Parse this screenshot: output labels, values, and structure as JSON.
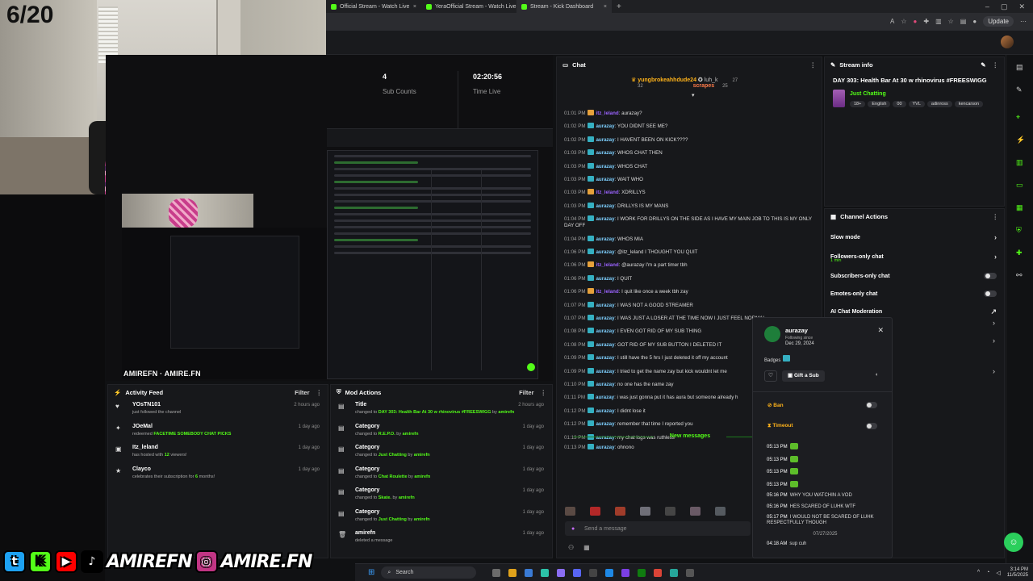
{
  "overlay": {
    "counter": "6/20",
    "handle": "AMIREFN",
    "handle2": "AMIRE.FN"
  },
  "browser": {
    "tabs": [
      {
        "title": "Official Stream - Watch Live"
      },
      {
        "title": "YeraOfficial Stream - Watch Live"
      },
      {
        "title": "Stream - Kick Dashboard"
      }
    ],
    "update_label": "Update"
  },
  "stats": {
    "sub_counts_value": "4",
    "sub_counts_label": "Sub Counts",
    "time_live_value": "02:20:56",
    "time_live_label": "Time Live"
  },
  "chat": {
    "title": "Chat",
    "pinned": {
      "user": "yungbrokeahhdude24",
      "user_count": "32",
      "u2": "luh_k",
      "u2_count": "27",
      "u3": "scrapes",
      "u3_count": "25"
    },
    "messages": [
      {
        "time": "01:01 PM",
        "user": "itz_leland",
        "badge": "o",
        "text": "aurazay?"
      },
      {
        "time": "01:02 PM",
        "user": "aurazay",
        "badge": "a",
        "text": "YOU DIDNT SEE ME?"
      },
      {
        "time": "01:02 PM",
        "user": "aurazay",
        "badge": "a",
        "text": "I HAVENT BEEN ON KICK????"
      },
      {
        "time": "01:03 PM",
        "user": "aurazay",
        "badge": "a",
        "text": "WHOS CHAT THEN"
      },
      {
        "time": "01:03 PM",
        "user": "aurazay",
        "badge": "a",
        "text": "WHOS CHAT"
      },
      {
        "time": "01:03 PM",
        "user": "aurazay",
        "badge": "a",
        "text": "WAIT WHO"
      },
      {
        "time": "01:03 PM",
        "user": "itz_leland",
        "badge": "o",
        "text": "XDRILLYS"
      },
      {
        "time": "01:03 PM",
        "user": "aurazay",
        "badge": "a",
        "text": "DRILLYS IS MY MANS"
      },
      {
        "time": "01:04 PM",
        "user": "aurazay",
        "badge": "a",
        "text": "I WORK FOR DRILLYS ON THE SIDE AS I HAVE MY MAIN JOB TO THIS IS MY ONLY DAY OFF"
      },
      {
        "time": "01:04 PM",
        "user": "aurazay",
        "badge": "a",
        "text": "WHOS MIA"
      },
      {
        "time": "01:06 PM",
        "user": "aurazay",
        "badge": "a",
        "text": "@itz_leland I THOUGHT YOU QUIT"
      },
      {
        "time": "01:06 PM",
        "user": "itz_leland",
        "badge": "o",
        "text": "@aurazay I'm a part timer tbh"
      },
      {
        "time": "01:06 PM",
        "user": "aurazay",
        "badge": "a",
        "text": "I QUIT"
      },
      {
        "time": "01:06 PM",
        "user": "itz_leland",
        "badge": "o",
        "text": "I quit like once a week tbh zay"
      },
      {
        "time": "01:07 PM",
        "user": "aurazay",
        "badge": "a",
        "text": "I WAS NOT A GOOD STREAMER"
      },
      {
        "time": "01:07 PM",
        "user": "aurazay",
        "badge": "a",
        "text": "I WAS JUST A LOSER AT THE TIME NOW I JUST FEEL NORMAL"
      },
      {
        "time": "01:08 PM",
        "user": "aurazay",
        "badge": "a",
        "text": "I EVEN GOT RID OF MY SUB THING"
      },
      {
        "time": "01:08 PM",
        "user": "aurazay",
        "badge": "a",
        "text": "GOT RID OF MY SUB BUTTON I DELETED IT"
      },
      {
        "time": "01:09 PM",
        "user": "aurazay",
        "badge": "a",
        "text": "I still have the 5 hrs I just deleted it off my account"
      },
      {
        "time": "01:09 PM",
        "user": "aurazay",
        "badge": "a",
        "text": "I tried to get the name zay but kick wouldnt let me"
      },
      {
        "time": "01:10 PM",
        "user": "aurazay",
        "badge": "a",
        "text": "no one has the name zay"
      },
      {
        "time": "01:11 PM",
        "user": "aurazay",
        "badge": "a",
        "text": "i was just gonna put it has aura but someone already h"
      },
      {
        "time": "01:12 PM",
        "user": "aurazay",
        "badge": "a",
        "text": "I didnt lose it"
      },
      {
        "time": "01:12 PM",
        "user": "aurazay",
        "badge": "a",
        "text": "remember that time I reported you"
      },
      {
        "time": "01:13 PM",
        "user": "aurazay",
        "badge": "a",
        "text": "my chat logs was ruthless"
      }
    ],
    "new_messages": "New messages",
    "last_message": {
      "time": "01:13 PM",
      "user": "aurazay",
      "text": "ohnono"
    },
    "send_placeholder": "Send a message"
  },
  "stream_info": {
    "title": "Stream info",
    "stream_title": "DAY 303: Health Bar At 30 w rhinovirus #FREESWIGG",
    "category": "Just Chatting",
    "tags": [
      "18+",
      "English",
      "00",
      "YVL",
      "adinross",
      "kencarson"
    ]
  },
  "channel_actions": {
    "title": "Channel Actions",
    "rows": [
      {
        "label": "Slow mode",
        "kind": "chevron"
      },
      {
        "label": "Followers-only chat",
        "sub": "1 min",
        "kind": "chevron"
      },
      {
        "label": "Subscribers-only chat",
        "kind": "toggle"
      },
      {
        "label": "Emotes-only chat",
        "kind": "toggle"
      },
      {
        "label": "AI Chat Moderation",
        "kind": "link"
      }
    ]
  },
  "activity_feed": {
    "title": "Activity Feed",
    "filter": "Filter",
    "items": [
      {
        "name": "YOsTN101",
        "pre": "just followed the channel",
        "hl": "",
        "post": "",
        "time": "2 hours ago",
        "icon": "♥"
      },
      {
        "name": "JOeMal",
        "pre": "redeemed",
        "hl": "FACETIME SOMEBODY CHAT PICKS",
        "post": "",
        "time": "1 day ago",
        "icon": "✦"
      },
      {
        "name": "Itz_leland",
        "pre": "has hosted with",
        "hl": "12",
        "post": "viewers!",
        "time": "1 day ago",
        "icon": "▣"
      },
      {
        "name": "Clayco",
        "pre": "celebrates their subscription for",
        "hl": "6",
        "post": "months!",
        "time": "1 day ago",
        "icon": "★"
      }
    ]
  },
  "mod_actions": {
    "title": "Mod Actions",
    "filter": "Filter",
    "items": [
      {
        "name": "Title",
        "pre": "changed to",
        "hl": "DAY 303: Health Bar At 30 w rhinovirus #FREESWIGG",
        "by": "amirefn",
        "time": "2 hours ago"
      },
      {
        "name": "Category",
        "pre": "changed to",
        "hl": "R.E.P.O.",
        "by": "amirefn",
        "time": "1 day ago"
      },
      {
        "name": "Category",
        "pre": "changed to",
        "hl": "Just Chatting",
        "by": "amirefn",
        "time": "1 day ago"
      },
      {
        "name": "Category",
        "pre": "changed to",
        "hl": "Chat Roulette",
        "by": "amirefn",
        "time": "1 day ago"
      },
      {
        "name": "Category",
        "pre": "changed to",
        "hl": "Skate.",
        "by": "amirefn",
        "time": "1 day ago"
      },
      {
        "name": "Category",
        "pre": "changed to",
        "hl": "Just Chatting",
        "by": "amirefn",
        "time": "1 day ago"
      },
      {
        "name": "amirefn",
        "pre": "deleted a message",
        "hl": "",
        "by": "",
        "time": "1 day ago"
      }
    ]
  },
  "user_card": {
    "username": "aurazay",
    "following_since": "Following since",
    "follow_date": "Dec 29, 2024",
    "badges_label": "Badges",
    "gift_label": "Gift a Sub",
    "ban_label": "Ban",
    "timeout_label": "Timeout",
    "log": [
      {
        "time": "05:13 PM",
        "text": "",
        "emote": true
      },
      {
        "time": "05:13 PM",
        "text": "",
        "emote": true
      },
      {
        "time": "05:13 PM",
        "text": "",
        "emote": true
      },
      {
        "time": "05:13 PM",
        "text": "",
        "emote": true
      },
      {
        "time": "05:16 PM",
        "text": "WHY YOU WATCHIN A VOD",
        "emote": false
      },
      {
        "time": "05:16 PM",
        "text": "HES SCARED OF LUHK WTF",
        "emote": false
      },
      {
        "time": "05:17 PM",
        "text": "I WOULD NOT BE SCARED OF LUHK RESPECTFULLY THOUGH",
        "emote": false
      }
    ],
    "date_sep": "07/27/2025",
    "last": {
      "time": "04:18 AM",
      "text": "sup cuh"
    }
  },
  "taskbar": {
    "search": "Search",
    "time": "3:14 PM",
    "date": "11/5/2025"
  }
}
